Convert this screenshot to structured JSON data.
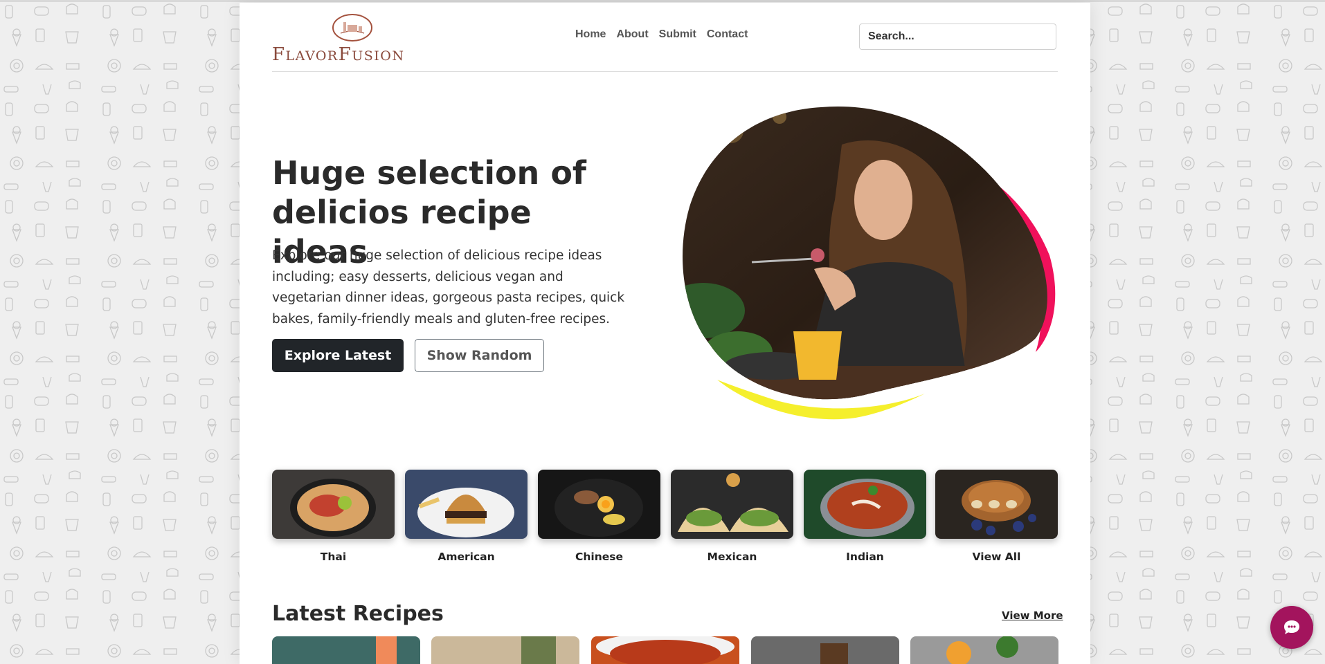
{
  "logo": {
    "text_first": "F",
    "text_second": "LAVOR",
    "text_third": "F",
    "text_fourth": "USION",
    "alt": "FlavorFusion"
  },
  "nav": {
    "items": [
      "Home",
      "About",
      "Submit",
      "Contact"
    ]
  },
  "search": {
    "placeholder": "Search..."
  },
  "hero": {
    "title": "Huge selection of delicios recipe ideas",
    "text": "Explore our huge selection of delicious recipe ideas including; easy desserts, delicious vegan and vegetarian dinner ideas, gorgeous pasta recipes, quick bakes, family-friendly meals and gluten-free recipes.",
    "primary_button": "Explore Latest",
    "secondary_button": "Show Random"
  },
  "categories": [
    {
      "label": "Thai",
      "icon": "thai-dish-icon"
    },
    {
      "label": "American",
      "icon": "burger-icon"
    },
    {
      "label": "Chinese",
      "icon": "noodle-bowl-icon"
    },
    {
      "label": "Mexican",
      "icon": "taco-icon"
    },
    {
      "label": "Indian",
      "icon": "curry-icon"
    },
    {
      "label": "View All",
      "icon": "pancakes-icon"
    }
  ],
  "latest": {
    "title": "Latest Recipes",
    "view_more": "View More"
  },
  "colors": {
    "brand": "#8a4a3c",
    "dark": "#212529",
    "chat": "#a3145d",
    "blob_pink": "#f0115b",
    "blob_yellow": "#f5ef2c"
  }
}
